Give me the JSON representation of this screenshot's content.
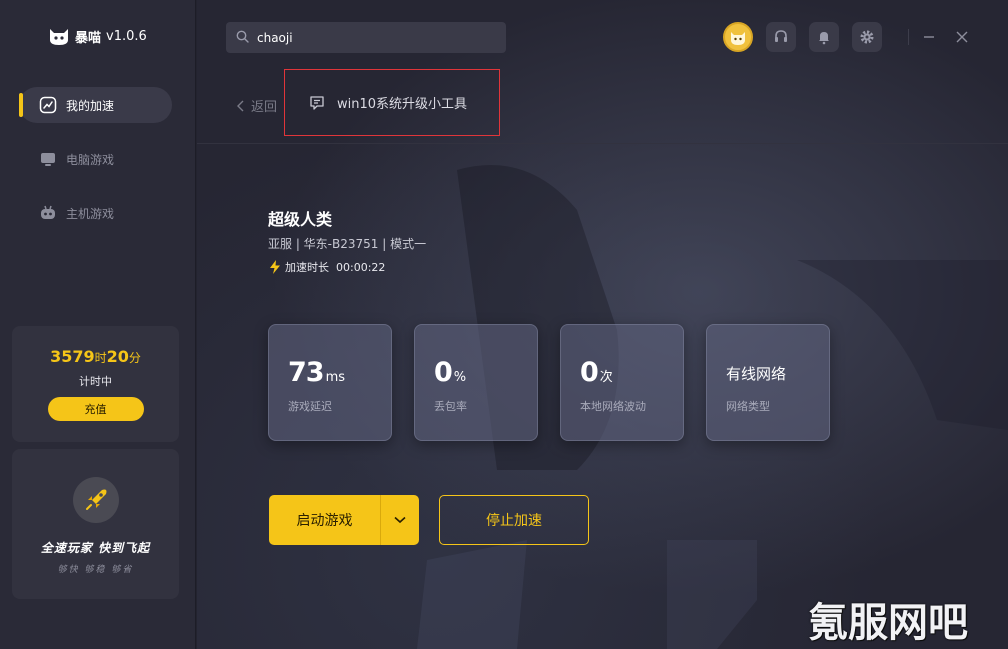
{
  "app": {
    "name": "暴喵",
    "version": "v1.0.6"
  },
  "sidebar": {
    "items": [
      {
        "label": "我的加速",
        "icon": "chart-icon",
        "active": true
      },
      {
        "label": "电脑游戏",
        "icon": "monitor-icon",
        "active": false
      },
      {
        "label": "主机游戏",
        "icon": "gamepad-icon",
        "active": false
      }
    ],
    "time_card": {
      "hours": "3579",
      "hours_unit": "时",
      "minutes": "20",
      "minutes_unit": "分",
      "status": "计时中",
      "button": "充值"
    },
    "promo": {
      "title": "全速玩家  快到飞起",
      "sub": "够快 够稳 够省"
    }
  },
  "search": {
    "value": "chaoji"
  },
  "header": {
    "back": "返回",
    "tool_label": "win10系统升级小工具"
  },
  "game": {
    "title": "超级人类",
    "meta": "亚服 | 华东-B23751 | 模式一",
    "time_label": "加速时长",
    "time_value": "00:00:22"
  },
  "stats": [
    {
      "value": "73",
      "unit": "ms",
      "label": "游戏延迟"
    },
    {
      "value": "0",
      "unit": "%",
      "label": "丢包率"
    },
    {
      "value": "0",
      "unit": "次",
      "label": "本地网络波动"
    },
    {
      "text": "有线网络",
      "label": "网络类型"
    }
  ],
  "buttons": {
    "start": "启动游戏",
    "stop": "停止加速"
  },
  "watermark": "氪服网吧",
  "colors": {
    "accent": "#f5c518",
    "sidebar": "#2a2a37",
    "highlight_border": "#e0353a"
  }
}
